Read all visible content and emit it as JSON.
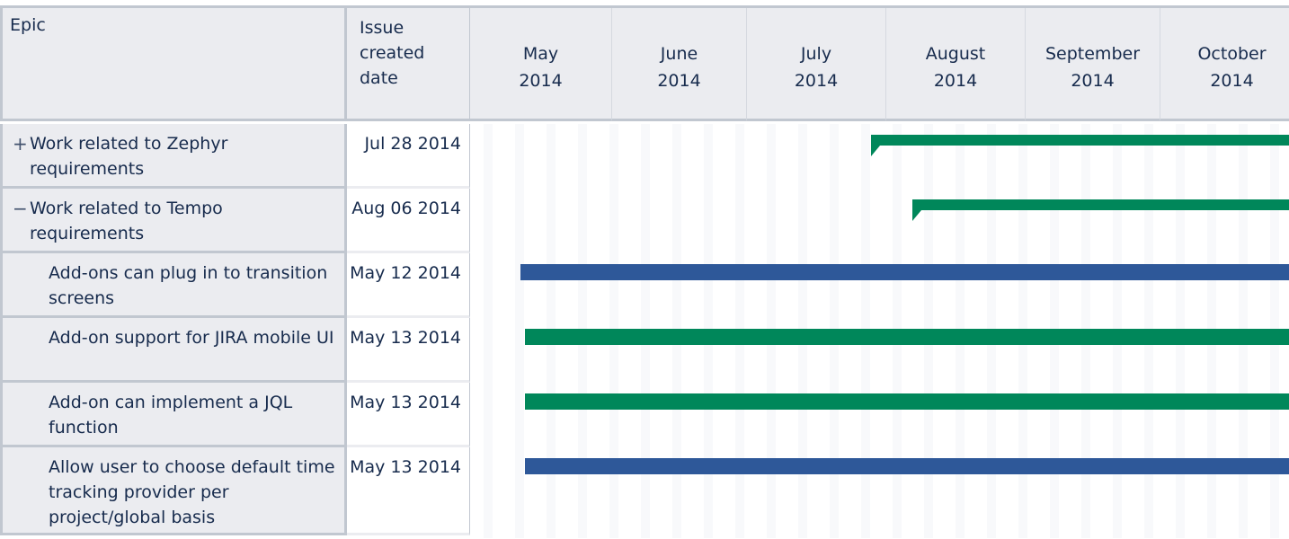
{
  "header": {
    "epic_label": "Epic",
    "date_label_lines": [
      "Issue",
      "created",
      "date"
    ]
  },
  "months": [
    {
      "name": "May",
      "year": "2014"
    },
    {
      "name": "June",
      "year": "2014"
    },
    {
      "name": "July",
      "year": "2014"
    },
    {
      "name": "August",
      "year": "2014"
    },
    {
      "name": "September",
      "year": "2014"
    },
    {
      "name": "October",
      "year": "2014"
    }
  ],
  "colors": {
    "epic_bar": "#00875a",
    "story_bar_green": "#00875a",
    "story_bar_blue": "#2e5899",
    "header_bg": "#ebecf0",
    "border": "#c1c7d0"
  },
  "rows": [
    {
      "type": "epic",
      "toggle": "+",
      "toggle_icon": "expand-icon",
      "label": "Work related to Zephyr requirements",
      "created": "Jul 28 2014",
      "bar_start": "2014-07-28",
      "bar_color": "#00875a",
      "bar_continues": true
    },
    {
      "type": "epic",
      "toggle": "−",
      "toggle_icon": "collapse-icon",
      "label": "Work related to Tempo requirements",
      "created": "Aug 06 2014",
      "bar_start": "2014-08-06",
      "bar_color": "#00875a",
      "bar_continues": true
    },
    {
      "type": "issue",
      "label": "Add-ons can plug in to transition screens",
      "created": "May 12 2014",
      "bar_start": "2014-05-12",
      "bar_color": "#2e5899",
      "bar_continues": true
    },
    {
      "type": "issue",
      "label": "Add-on support for JIRA mobile UI",
      "created": "May 13 2014",
      "bar_start": "2014-05-13",
      "bar_color": "#00875a",
      "bar_continues": true
    },
    {
      "type": "issue",
      "label": "Add-on can implement a JQL function",
      "created": "May 13 2014",
      "bar_start": "2014-05-13",
      "bar_color": "#00875a",
      "bar_continues": true
    },
    {
      "type": "issue",
      "label": "Allow user to choose default time tracking provider per project/global basis",
      "created": "May 13 2014",
      "bar_start": "2014-05-13",
      "bar_color": "#2e5899",
      "bar_continues": true
    }
  ]
}
